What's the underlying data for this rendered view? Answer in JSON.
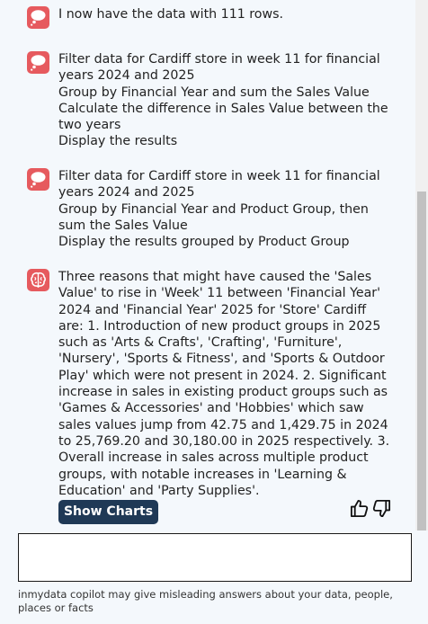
{
  "messages": [
    {
      "type": "thought",
      "lines": [
        "I now have the data with 111 rows."
      ]
    },
    {
      "type": "thought",
      "lines": [
        "Filter data for Cardiff store in week 11 for financial",
        "years 2024 and 2025",
        "Group by Financial Year and sum the Sales Value",
        "Calculate the difference in Sales Value between the",
        "two years",
        "Display the results"
      ]
    },
    {
      "type": "thought",
      "lines": [
        "Filter data for Cardiff store in week 11 for financial",
        "years 2024 and 2025",
        "Group by Financial Year and Product Group, then",
        "sum the Sales Value",
        "Display the results grouped by Product Group"
      ]
    },
    {
      "type": "answer",
      "lines": [
        "Three reasons that might have caused the 'Sales",
        "Value' to rise in 'Week' 11 between 'Financial Year'",
        "2024 and 'Financial Year' 2025 for 'Store' Cardiff",
        "are: 1. Introduction of new product groups in 2025",
        "such as 'Arts & Crafts', 'Crafting', 'Furniture',",
        "'Nursery', 'Sports & Fitness', and 'Sports & Outdoor",
        "Play' which were not present in 2024. 2. Significant",
        "increase in sales in existing product groups such as",
        "'Games & Accessories' and 'Hobbies' which saw",
        "sales values jump from 42.75 and 1,429.75 in 2024",
        "to 25,769.20 and 30,180.00 in 2025 respectively. 3.",
        "Overall increase in sales across multiple product",
        "groups, with notable increases in 'Learning &",
        "Education' and 'Party Supplies'."
      ]
    }
  ],
  "actions": {
    "show_charts_label": "Show Charts",
    "thumbs_up_icon": "thumbs-up-icon",
    "thumbs_down_icon": "thumbs-down-icon"
  },
  "input": {
    "value": "",
    "placeholder": ""
  },
  "disclaimer": "inmydata copilot may give misleading answers about your data, people, places or facts",
  "colors": {
    "icon_bg": "#e65a5e",
    "button_bg": "#1f3956",
    "page_bg": "#f4f8fc"
  }
}
